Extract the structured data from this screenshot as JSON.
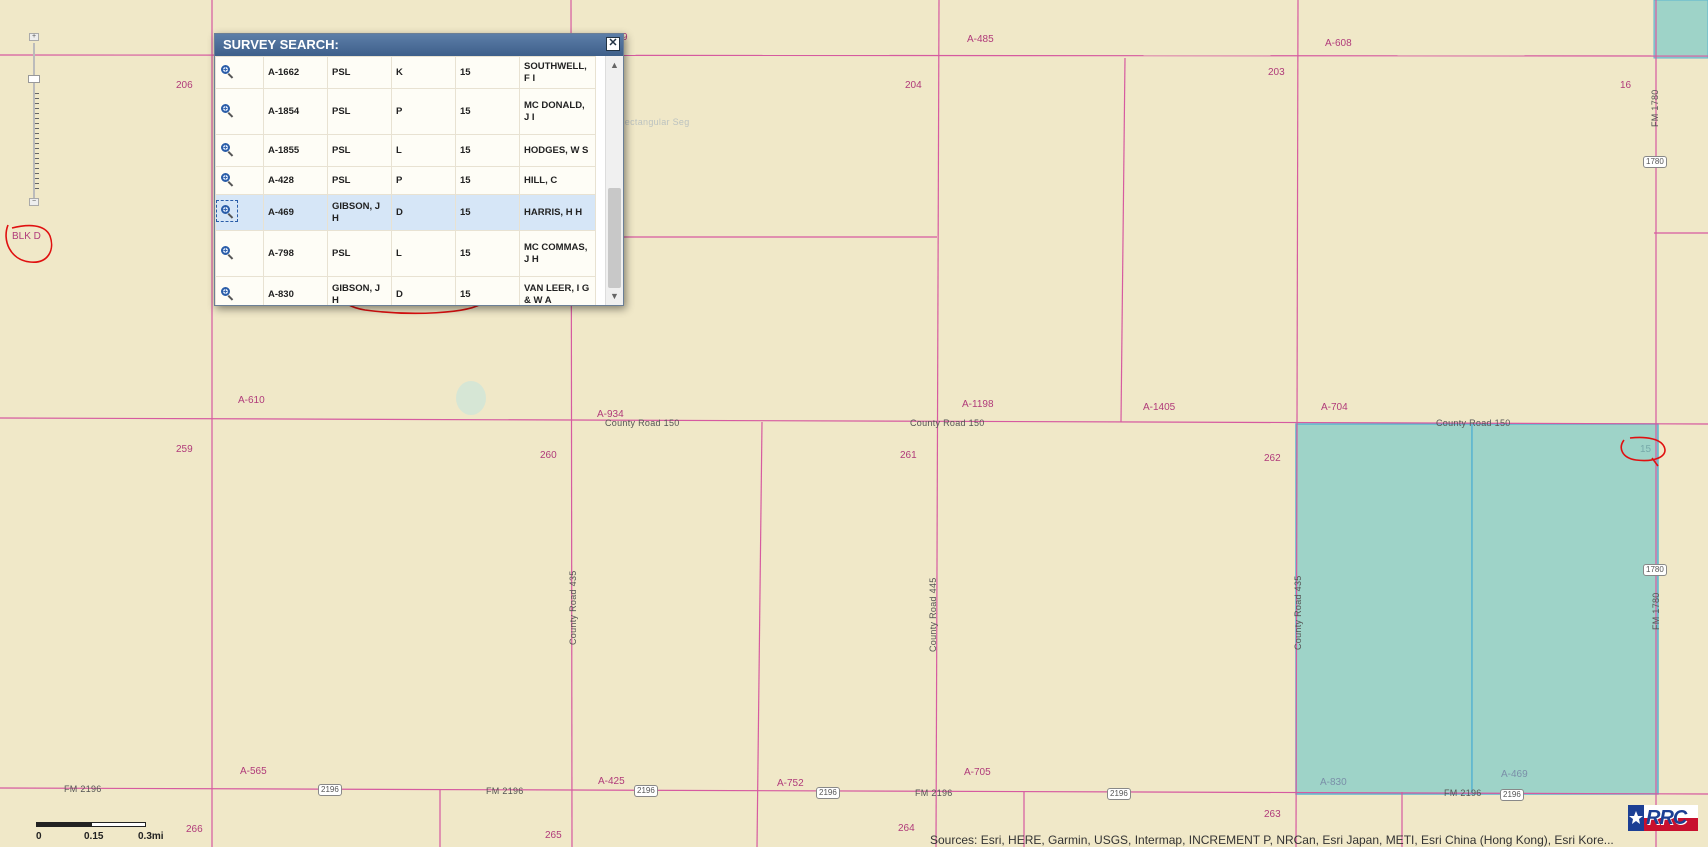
{
  "map": {
    "section_labels": [
      "206",
      "204",
      "203",
      "16",
      "259",
      "260",
      "261",
      "262",
      "266",
      "265",
      "264",
      "263",
      "BLK D",
      "15"
    ],
    "abstract_labels": [
      "A-485",
      "A-608",
      "A-610",
      "A-934",
      "A-1198",
      "A-1405",
      "A-704",
      "A-565",
      "A-425",
      "A-752",
      "A-705",
      "A-830",
      "A-469",
      "9"
    ],
    "roads": [
      "County Road 150",
      "County Road 150",
      "County Road 150",
      "County Road 435",
      "County Road 445",
      "County Road 435",
      "FM 1780",
      "FM 1780",
      "FM 2196",
      "FM 2196",
      "FM 2196",
      "FM 2196"
    ],
    "shields": [
      "1780",
      "1780",
      "2196",
      "2196",
      "2196",
      "2196",
      "2196"
    ],
    "hint_text": "Rectangular Seg"
  },
  "survey_search": {
    "title": "SURVEY SEARCH:",
    "close_label": "✕",
    "rows": [
      {
        "abstract": "A-1662",
        "col2": "PSL",
        "col3": "K",
        "col4": "15",
        "name": "SOUTHWELL, F I"
      },
      {
        "abstract": "A-1854",
        "col2": "PSL",
        "col3": "P",
        "col4": "15",
        "name": "MC DONALD, J I"
      },
      {
        "abstract": "A-1855",
        "col2": "PSL",
        "col3": "L",
        "col4": "15",
        "name": "HODGES, W S"
      },
      {
        "abstract": "A-428",
        "col2": "PSL",
        "col3": "P",
        "col4": "15",
        "name": "HILL, C"
      },
      {
        "abstract": "A-469",
        "col2": "GIBSON, J H",
        "col3": "D",
        "col4": "15",
        "name": "HARRIS, H H"
      },
      {
        "abstract": "A-798",
        "col2": "PSL",
        "col3": "L",
        "col4": "15",
        "name": "MC COMMAS, J H"
      },
      {
        "abstract": "A-830",
        "col2": "GIBSON, J H",
        "col3": "D",
        "col4": "15",
        "name": "VAN LEER, I G & W A"
      }
    ]
  },
  "scale_bar": {
    "labels": [
      "0",
      "0.15",
      "0.3mi"
    ]
  },
  "attribution": "Sources: Esri, HERE, Garmin, USGS, Intermap, INCREMENT P, NRCan, Esri Japan, METI, Esri China (Hong Kong), Esri Kore...",
  "logo_text": "RRC",
  "colors": {
    "map_bg": "#f0e8c8",
    "boundary": "#d65aa0",
    "highlight_fill": "#9ed3c8",
    "highlight_stroke": "#5bb5d0",
    "annotation": "#e01010"
  }
}
